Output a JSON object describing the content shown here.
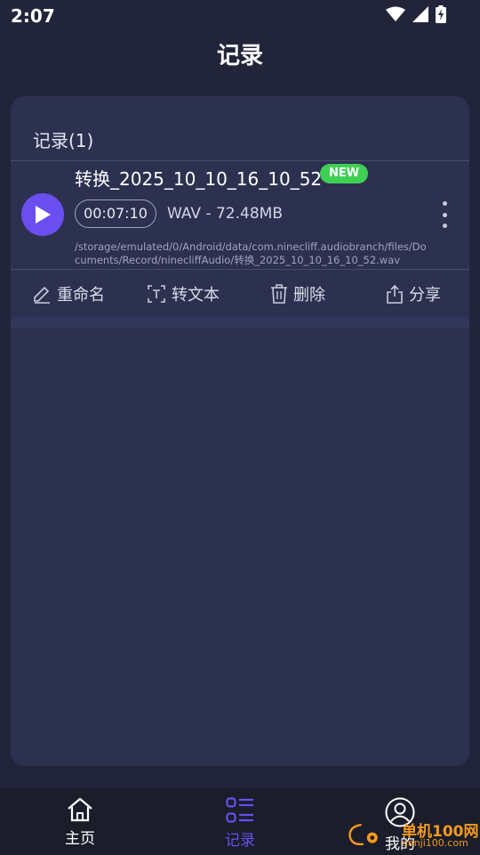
{
  "status_bar": {
    "time": "2:07"
  },
  "page": {
    "title": "记录"
  },
  "card": {
    "header": "记录(1)",
    "recording": {
      "name": "转换_2025_10_10_16_10_52",
      "badge": "NEW",
      "duration": "00:07:10",
      "info": "WAV - 72.48MB",
      "path": "/storage/emulated/0/Android/data/com.ninecliff.audiobranch/files/Documents/Record/ninecliffAudio/转换_2025_10_10_16_10_52.wav"
    },
    "actions": {
      "rename": "重命名",
      "to_text": "转文本",
      "delete": "删除",
      "share": "分享"
    }
  },
  "bottom_nav": {
    "home": "主页",
    "records": "记录",
    "mine": "我的"
  },
  "watermark": {
    "line1": "单机100网",
    "line2": "danji100.com"
  },
  "colors": {
    "accent": "#6a4ef0",
    "badge": "#3fcf54",
    "card": "#2d3150",
    "background": "#22253a"
  }
}
